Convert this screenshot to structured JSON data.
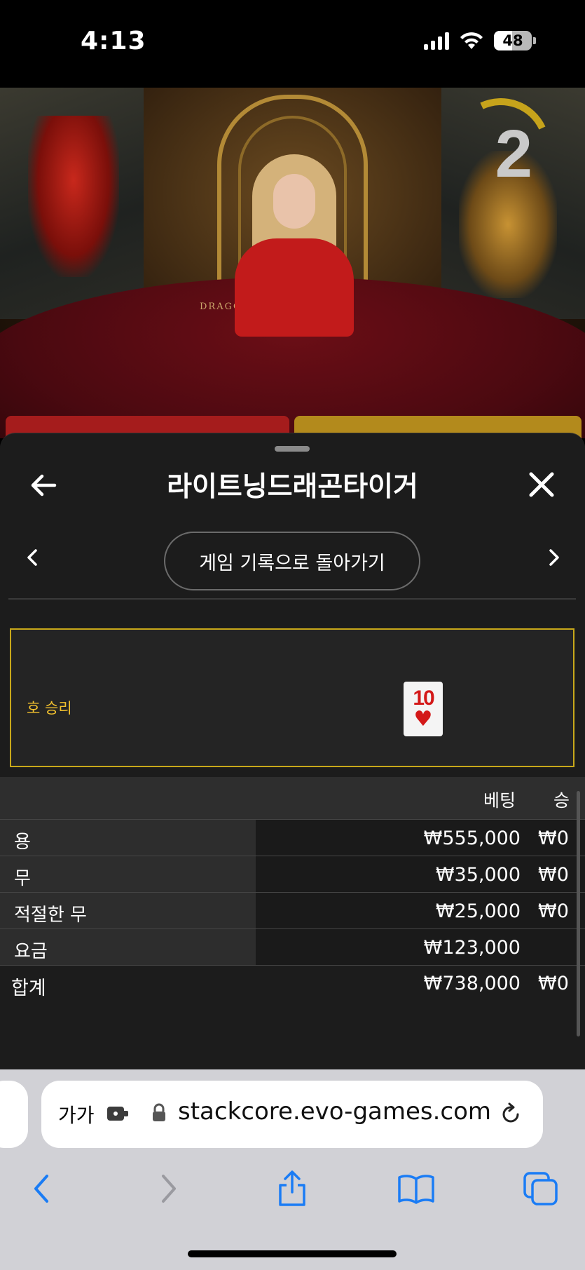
{
  "status_bar": {
    "time": "4:13",
    "battery": "48"
  },
  "video": {
    "countdown": "2",
    "table_label": "DRAGON TIGER"
  },
  "sheet": {
    "title": "라이트닝드래곤타이거",
    "back_to_history": "게임 기록으로 돌아가기",
    "result": {
      "label": "호 승리",
      "card_rank": "10",
      "card_suit": "♥"
    },
    "bets_header": {
      "bet": "베팅",
      "win": "승"
    },
    "bets": [
      {
        "name": "용",
        "amount": "₩555,000",
        "win": "₩0"
      },
      {
        "name": "무",
        "amount": "₩35,000",
        "win": "₩0"
      },
      {
        "name": "적절한 무",
        "amount": "₩25,000",
        "win": "₩0"
      },
      {
        "name": "요금",
        "amount": "₩123,000",
        "win": ""
      }
    ],
    "total": {
      "name": "합계",
      "amount": "₩738,000",
      "win": "₩0"
    }
  },
  "browser": {
    "aa_label": "가가",
    "url": "stackcore.evo-games.com"
  },
  "colors": {
    "accent_gold": "#c8a81a",
    "result_text": "#f2c12e",
    "safari_blue": "#1a7cf5"
  }
}
